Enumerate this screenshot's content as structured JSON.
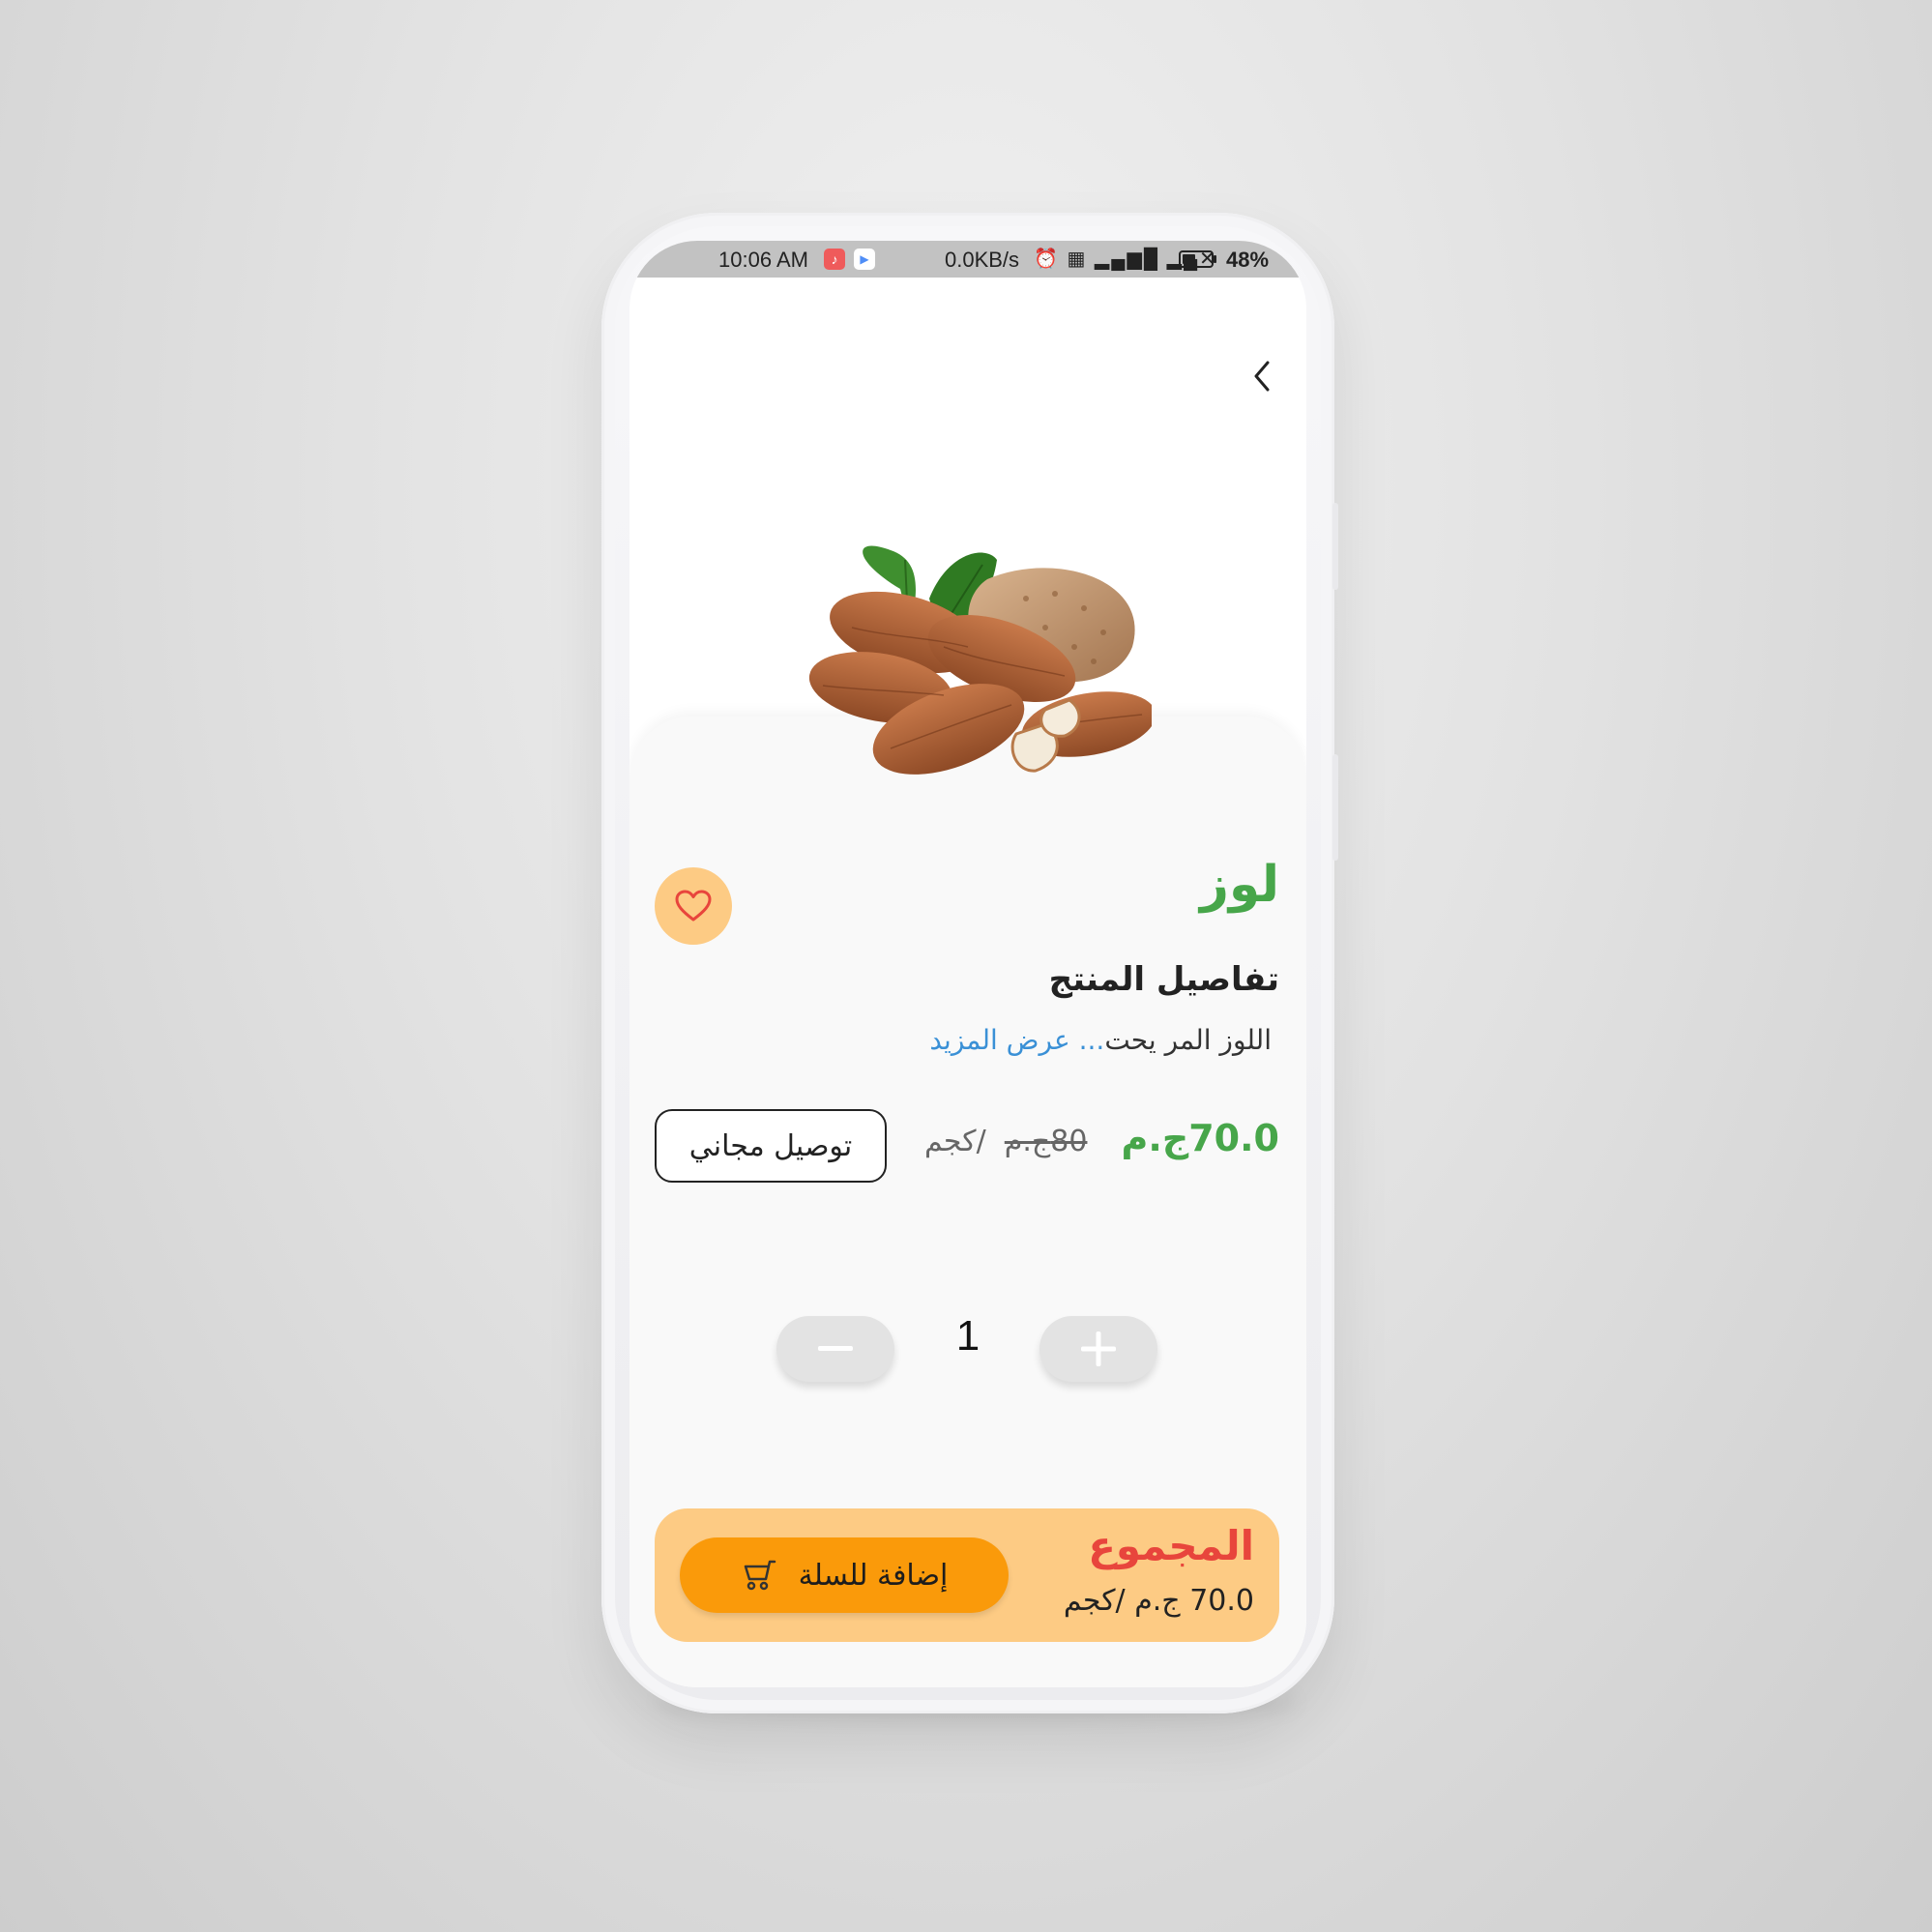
{
  "status_bar": {
    "time": "10:06 AM",
    "network_speed": "0.0KB/s",
    "battery_level": 0.48,
    "battery_percent": "48%"
  },
  "product": {
    "name": "لوز",
    "details_heading": "تفاصيل المنتج",
    "description": "اللوز المر يحت",
    "ellipsis": "...",
    "show_more": "عرض المزيد",
    "current_price": "70.0ج.م",
    "old_price": "80ج.م",
    "unit": "/كجم",
    "free_delivery": "توصيل مجاني"
  },
  "quantity": {
    "value": "1"
  },
  "total": {
    "label": "المجموع",
    "value": "70.0 ج.م",
    "unit": "/كجم",
    "add_to_cart": "إضافة للسلة"
  },
  "colors": {
    "accent_green": "#47a64a",
    "accent_orange": "#fa9a0a",
    "light_orange": "#fdcb84",
    "total_red": "#e8453c",
    "link_blue": "#3a90d6"
  },
  "icons": {
    "back": "chevron-left-icon",
    "favorite": "heart-icon",
    "cart": "cart-icon",
    "minus": "minus-icon",
    "plus": "plus-icon"
  }
}
